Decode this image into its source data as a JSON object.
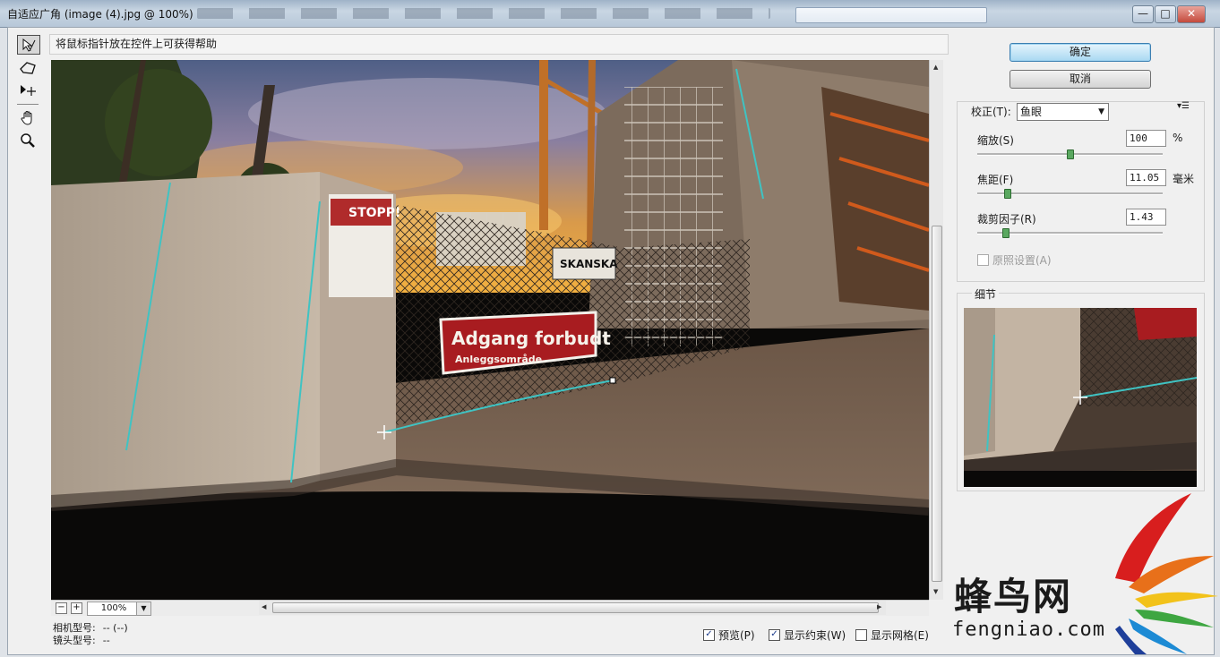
{
  "window": {
    "title": "自适应广角 (image (4).jpg @ 100%)",
    "minimize_glyph": "—",
    "maximize_glyph": "□",
    "close_glyph": "✕"
  },
  "hint": "将鼠标指针放在控件上可获得帮助",
  "tools": [
    {
      "icon": "constraint-tool-icon"
    },
    {
      "icon": "polygon-constraint-tool-icon"
    },
    {
      "icon": "move-tool-icon"
    },
    {
      "icon": "hand-tool-icon"
    },
    {
      "icon": "zoom-tool-icon"
    }
  ],
  "buttons": {
    "ok": "确定",
    "cancel": "取消"
  },
  "correction": {
    "label": "校正(T):",
    "selected": "鱼眼",
    "scale": {
      "label": "缩放(S)",
      "value": "100",
      "unit": "%",
      "level": 0.5
    },
    "focal": {
      "label": "焦距(F)",
      "value": "11.05",
      "unit": "毫米",
      "level": 0.15
    },
    "crop": {
      "label": "裁剪因子(R)",
      "value": "1.43",
      "unit": "",
      "level": 0.14
    },
    "as_shot": {
      "label": "原照设置(A)",
      "checked": false,
      "enabled": false
    }
  },
  "detail": {
    "label": "细节"
  },
  "zoom": {
    "value": "100%",
    "minus": "−",
    "plus": "+"
  },
  "info": {
    "camera_label": "相机型号:",
    "camera_value": "-- (--)",
    "lens_label": "镜头型号:",
    "lens_value": "--"
  },
  "checkboxes": {
    "preview": {
      "label": "预览(P)",
      "checked": true
    },
    "show_constraints": {
      "label": "显示约束(W)",
      "checked": true
    },
    "show_grid": {
      "label": "显示网格(E)",
      "checked": false
    }
  },
  "photo": {
    "sign_stop": "STOPP!",
    "sign_main": "Adgang forbudt",
    "sign_sub": "Anleggsområde",
    "sign_brand": "SKANSKA"
  },
  "watermark": {
    "cn": "蜂鸟网",
    "en": "fengniao.com"
  },
  "colors": {
    "constraint": "#3fc3c3",
    "ok_button": "#a9d9f2",
    "slider_thumb": "#5aa860"
  }
}
